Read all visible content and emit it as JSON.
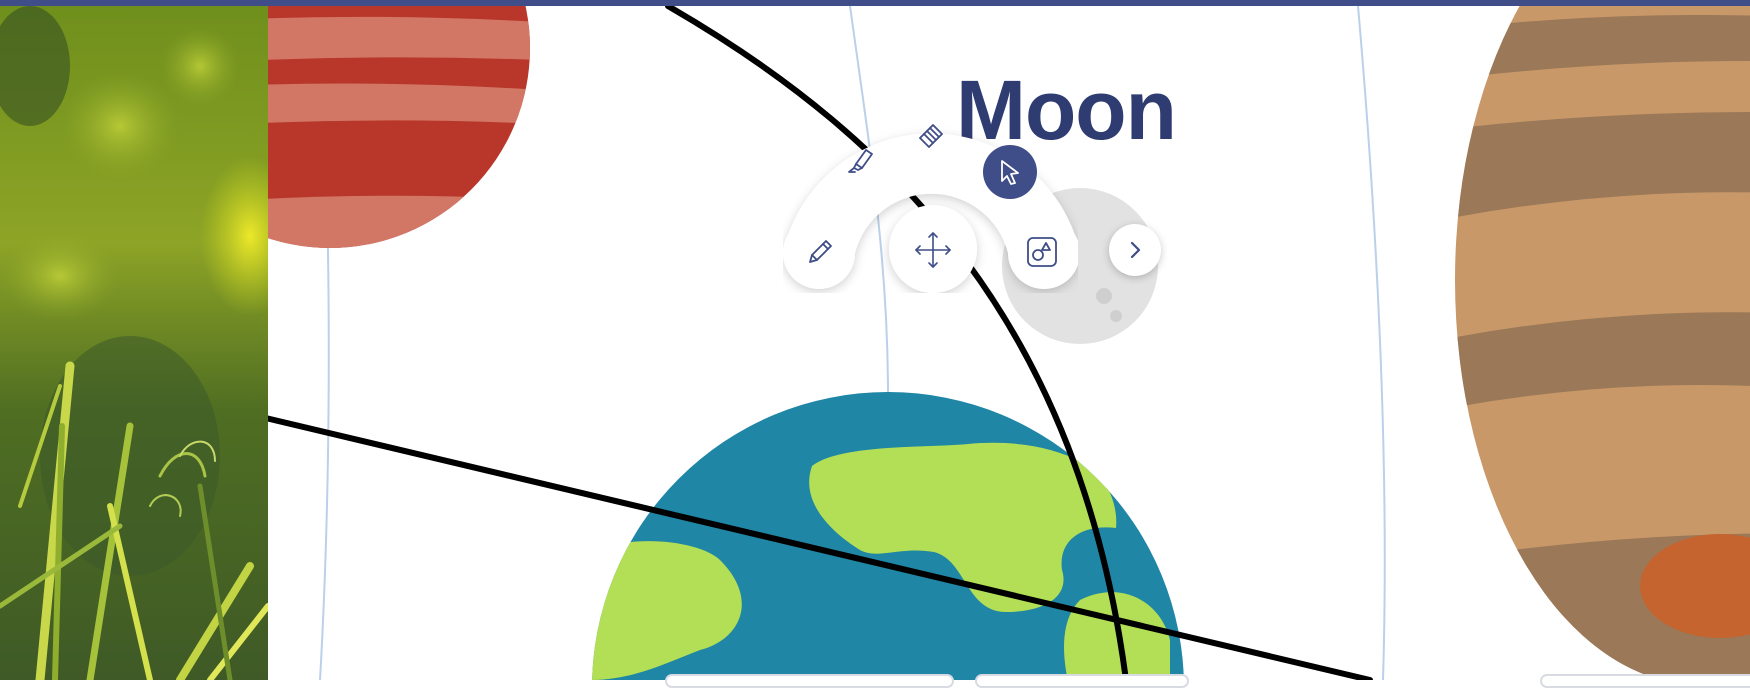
{
  "canvas": {
    "label": "Moon",
    "planets": [
      "mars",
      "moon",
      "earth",
      "jupiter"
    ]
  },
  "toolbar": {
    "tools": [
      {
        "id": "highlighter",
        "icon": "highlighter-icon",
        "active": false
      },
      {
        "id": "eraser",
        "icon": "eraser-icon",
        "active": false
      },
      {
        "id": "select",
        "icon": "cursor-icon",
        "active": true
      },
      {
        "id": "pen",
        "icon": "pencil-icon",
        "active": false
      },
      {
        "id": "pan",
        "icon": "move-icon",
        "active": false
      },
      {
        "id": "shapes",
        "icon": "shapes-icon",
        "active": false
      }
    ],
    "expand_icon": "chevron-right-icon"
  },
  "colors": {
    "top_bar": "#3f4d88",
    "accent": "#3f4d88",
    "icon": "#3f4d88",
    "mars_dark": "#b8372a",
    "mars_light": "#d27766",
    "earth_ocean": "#1f86a5",
    "earth_land": "#b2df55",
    "jupiter_light": "#c99868",
    "jupiter_dark": "#9a7858",
    "jupiter_spot": "#c5642e",
    "moon": "#e2e2e2",
    "ink": "#000000",
    "guide": "#bcd0ea"
  }
}
